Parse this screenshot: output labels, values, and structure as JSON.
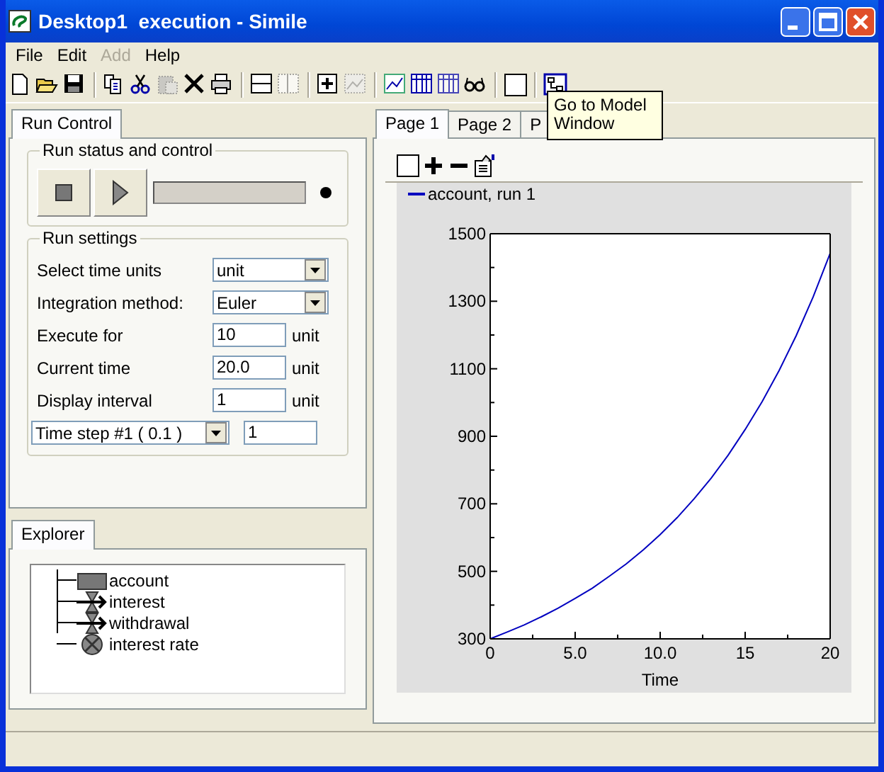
{
  "window": {
    "title": "Desktop1  execution - Simile"
  },
  "menu": [
    {
      "label": "File",
      "disabled": false
    },
    {
      "label": "Edit",
      "disabled": false
    },
    {
      "label": "Add",
      "disabled": true
    },
    {
      "label": "Help",
      "disabled": false
    }
  ],
  "toolbar": [
    [
      {
        "kind": "new",
        "disabled": false
      },
      {
        "kind": "open",
        "disabled": false
      },
      {
        "kind": "save",
        "disabled": false
      }
    ],
    [
      {
        "kind": "copy",
        "disabled": false
      },
      {
        "kind": "cut",
        "disabled": false
      },
      {
        "kind": "paste",
        "disabled": true
      },
      {
        "kind": "delete",
        "disabled": false
      },
      {
        "kind": "print",
        "disabled": false
      }
    ],
    [
      {
        "kind": "split-h",
        "disabled": false
      },
      {
        "kind": "split-v",
        "disabled": true
      }
    ],
    [
      {
        "kind": "add-page",
        "disabled": false
      },
      {
        "kind": "graph",
        "disabled": true
      }
    ],
    [
      {
        "kind": "plot",
        "disabled": false
      },
      {
        "kind": "table",
        "disabled": false
      },
      {
        "kind": "table",
        "disabled": true
      },
      {
        "kind": "glasses",
        "disabled": false
      }
    ],
    [
      {
        "kind": "blank",
        "disabled": false
      }
    ],
    [
      {
        "kind": "model",
        "disabled": false
      }
    ]
  ],
  "tooltip": "Go to Model Window",
  "left": {
    "tabs": [
      {
        "label": "Run Control",
        "selected": true
      }
    ],
    "run_status": {
      "title": "Run status and control",
      "progress": {
        "level": 0
      },
      "running": false
    },
    "run_settings": {
      "title": "Run settings",
      "rows": [
        {
          "kind": "select",
          "label": "Select time units",
          "value": "unit"
        },
        {
          "kind": "select",
          "label": "Integration method:",
          "value": "Euler"
        },
        {
          "kind": "input",
          "label": "Execute for",
          "value": "10",
          "unit": "unit"
        },
        {
          "kind": "input",
          "label": "Current time",
          "value": "20.0",
          "unit": "unit"
        },
        {
          "kind": "input",
          "label": "Display interval",
          "value": "1",
          "unit": "unit"
        }
      ],
      "time_step": {
        "value": "Time step #1 ( 0.1 )",
        "field": "1"
      }
    },
    "explorer": {
      "tabs": [
        {
          "label": "Explorer",
          "selected": true
        }
      ],
      "tree": [
        {
          "kind": "compartment",
          "label": "account"
        },
        {
          "kind": "flow",
          "label": "interest"
        },
        {
          "kind": "flow",
          "label": "withdrawal"
        },
        {
          "kind": "variable",
          "label": "interest rate"
        }
      ]
    }
  },
  "right": {
    "tabs": [
      {
        "label": "Page 1",
        "selected": true
      },
      {
        "label": "Page 2",
        "selected": false
      },
      {
        "label": "P",
        "selected": false
      }
    ],
    "graph_toolbar": [
      {
        "kind": "blank"
      },
      {
        "kind": "plus"
      },
      {
        "kind": "minus"
      },
      {
        "kind": "properties"
      }
    ],
    "chart_data": {
      "type": "line",
      "xlabel": "Time",
      "x": [
        0,
        1,
        2,
        3,
        4,
        5,
        6,
        7,
        8,
        9,
        10,
        11,
        12,
        13,
        14,
        15,
        16,
        17,
        18,
        19,
        20
      ],
      "series": [
        {
          "name": "account, run 1",
          "color": "#0000c0",
          "values": [
            300,
            320,
            341,
            365,
            391,
            420,
            450,
            485,
            522,
            563,
            609,
            659,
            715,
            776,
            844,
            920,
            1003,
            1095,
            1198,
            1313,
            1442
          ]
        }
      ],
      "xlim": [
        0,
        20
      ],
      "ylim": [
        300,
        1500
      ],
      "xticks": [
        0,
        {
          "value": 5,
          "label": "5.0"
        },
        {
          "value": 10,
          "label": "10.0"
        },
        15,
        20
      ],
      "yticks": [
        300,
        500,
        700,
        900,
        1100,
        1300,
        1500
      ]
    }
  }
}
